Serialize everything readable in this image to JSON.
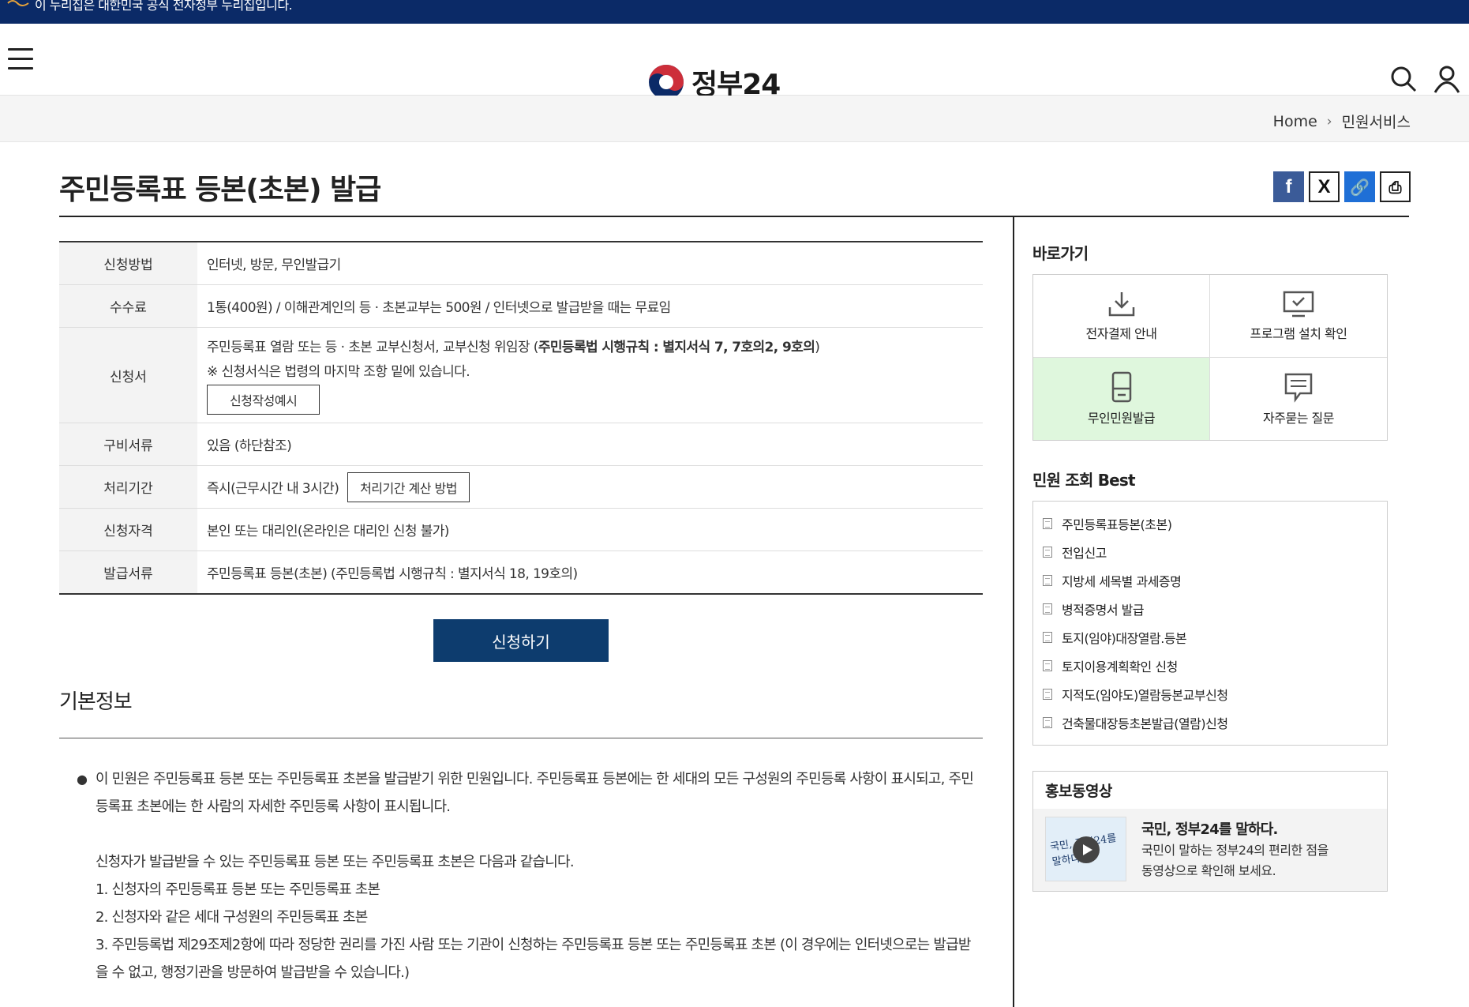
{
  "banner": {
    "text": "이 누리집은 대한민국 공식 전자정부 누리집입니다."
  },
  "header": {
    "logo_text": "정부24"
  },
  "breadcrumb": {
    "home": "Home",
    "current": "민원서비스"
  },
  "page": {
    "title": "주민등록표 등본(초본) 발급"
  },
  "info_rows": [
    {
      "label": "신청방법",
      "value": "인터넷, 방문, 무인발급기"
    },
    {
      "label": "수수료",
      "value": "1통(400원) / 이해관계인의 등 · 초본교부는 500원 / 인터넷으로 발급받을 때는 무료임"
    },
    {
      "label": "신청서",
      "value_prefix": "주민등록표 열람 또는 등 · 초본 교부신청서, 교부신청 위임장 (",
      "value_bold": "주민등록법 시행규칙 : 별지서식 7, 7호의2, 9호의",
      "value_suffix": ")",
      "note": "※ 신청서식은 법령의 마지막 조항 밑에 있습니다.",
      "button": "신청작성예시"
    },
    {
      "label": "구비서류",
      "value": "있음 (하단참조)"
    },
    {
      "label": "처리기간",
      "value": "즉시(근무시간 내 3시간)",
      "button": "처리기간 계산 방법"
    },
    {
      "label": "신청자격",
      "value": "본인 또는 대리인(온라인은 대리인 신청 불가)"
    },
    {
      "label": "발급서류",
      "value": "주민등록표 등본(초본) (주민등록법 시행규칙 : 별지서식 18, 19호의)"
    }
  ],
  "apply_button": "신청하기",
  "basic_info": {
    "title": "기본정보",
    "paragraph1": "이 민원은 주민등록표 등본 또는 주민등록표 초본을 발급받기 위한 민원입니다. 주민등록표 등본에는 한 세대의 모든 구성원의 주민등록 사항이 표시되고, 주민등록표 초본에는 한 사람의 자세한 주민등록 사항이 표시됩니다.",
    "paragraph2": "신청자가 발급받을 수 있는 주민등록표 등본 또는 주민등록표 초본은 다음과 같습니다.",
    "item1": "1. 신청자의 주민등록표 등본 또는 주민등록표 초본",
    "item2": "2. 신청자와 같은 세대 구성원의 주민등록표 초본",
    "item3": "3. 주민등록법 제29조제2항에 따라 정당한 권리를 가진 사람 또는 기관이 신청하는 주민등록표 등본 또는 주민등록표 초본 (이 경우에는 인터넷으로는 발급받을 수 없고, 행정기관을 방문하여 발급받을 수 있습니다.)"
  },
  "sidebar": {
    "shortcuts_title": "바로가기",
    "shortcuts": [
      {
        "label": "전자결제 안내",
        "icon": "download-icon"
      },
      {
        "label": "프로그램 설치 확인",
        "icon": "monitor-check-icon"
      },
      {
        "label": "무인민원발급",
        "icon": "kiosk-icon"
      },
      {
        "label": "자주묻는 질문",
        "icon": "chat-icon"
      }
    ],
    "best_title": "민원 조회 Best",
    "best_items": [
      "주민등록표등본(초본)",
      "전입신고",
      "지방세 세목별 과세증명",
      "병적증명서 발급",
      "토지(임야)대장열람.등본",
      "토지이용계획확인 신청",
      "지적도(임야도)열람등본교부신청",
      "건축물대장등초본발급(열람)신청"
    ],
    "promo": {
      "title": "홍보동영상",
      "thumb_text": "국민, 정부24를 말하다",
      "video_title": "국민, 정부24를 말하다.",
      "video_desc1": "국민이 말하는 정부24의 편리한 점을",
      "video_desc2": "동영상으로 확인해 보세요."
    }
  },
  "colors": {
    "banner": "#0b2a67",
    "apply_button": "#0d3c6e",
    "highlight": "#dff7dd"
  }
}
